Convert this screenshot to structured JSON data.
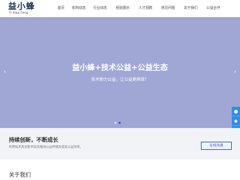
{
  "header": {
    "logo_cn": "益小蜂",
    "logo_en": "Yi Xiao Feng",
    "nav": [
      {
        "label": "首页",
        "active": true
      },
      {
        "label": "机构动态",
        "active": false
      },
      {
        "label": "行业动态",
        "active": false
      },
      {
        "label": "经验展示",
        "active": false
      },
      {
        "label": "人才招聘",
        "active": false
      },
      {
        "label": "常见问题",
        "active": false
      },
      {
        "label": "关于我们",
        "active": false
      },
      {
        "label": "公益合作",
        "active": false
      }
    ]
  },
  "hero": {
    "title": "益小蜂+技术公益+公益生态",
    "subtitle": "技术助力公益，让公益更高效！",
    "prev_icon": "‹",
    "next_icon": "›",
    "slide_count": 2,
    "active_slide": 1,
    "background": "#a1a7d4"
  },
  "side_tools": [
    {
      "icon": "chat-bubble-icon",
      "glyph": "●"
    },
    {
      "icon": "qq-icon",
      "glyph": "◆"
    },
    {
      "icon": "wechat-icon",
      "glyph": "◉"
    }
  ],
  "promo": {
    "title": "持续创新，不断成长",
    "description": "利用技术及创新手段去推动公益传播及提高公益效率。",
    "button_label": "在线沟通"
  },
  "about": {
    "title": "关于我们"
  },
  "colors": {
    "accent": "#3a5db6",
    "side_tool": "#2b8cf2"
  }
}
